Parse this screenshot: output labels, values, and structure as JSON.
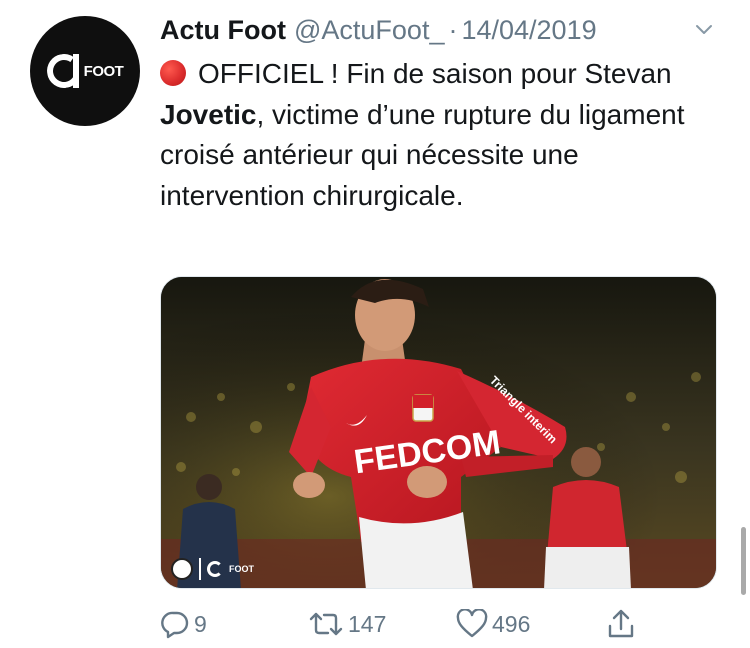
{
  "account": {
    "display_name": "Actu Foot",
    "handle": "@ActuFoot_",
    "separator": "·",
    "date": "14/04/2019",
    "avatar_text": "FOOT"
  },
  "tweet": {
    "emoji": "red-circle",
    "text_part1": "OFFICIEL ! Fin de saison pour Stevan ",
    "text_bold": "Jovetic",
    "text_part2": ", victime d’une rupture du ligament croisé antérieur qui nécessite une intervention chirurgicale."
  },
  "media": {
    "jersey_text": "FEDCOM",
    "sponsor_text": "Triangle interim",
    "watermark_text": "FOOT"
  },
  "actions": {
    "reply_count": "9",
    "retweet_count": "147",
    "like_count": "496"
  },
  "icons": [
    "chevron-down-icon",
    "reply-icon",
    "retweet-icon",
    "heart-icon",
    "share-icon"
  ],
  "colors": {
    "text": "#14171a",
    "secondary": "#657786",
    "kit_red": "#d21f2a",
    "emoji_red": "#dd2e2e"
  }
}
